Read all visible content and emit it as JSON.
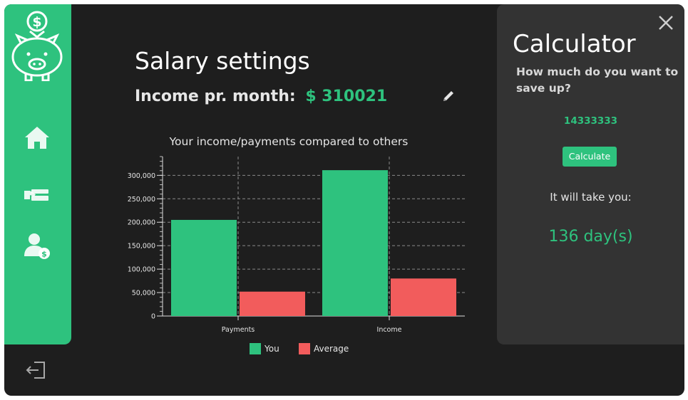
{
  "main": {
    "title": "Salary settings",
    "income_label": "Income pr. month:",
    "income_value": "$ 310021"
  },
  "icons": {
    "logo": "piggy-bank-icon",
    "nav": [
      "home-icon",
      "payments-icon",
      "user-salary-icon"
    ],
    "logout": "logout-icon",
    "edit": "pencil-icon",
    "close": "close-icon"
  },
  "colors": {
    "accent": "#2ec27e",
    "average": "#f25c5c",
    "background": "#1e1e1e",
    "panel": "#333333"
  },
  "chart_data": {
    "type": "bar",
    "title": "Your income/payments compared to others",
    "categories": [
      "Payments",
      "Income"
    ],
    "series": [
      {
        "name": "You",
        "values": [
          205000,
          311000
        ]
      },
      {
        "name": "Average",
        "values": [
          52000,
          80000
        ]
      }
    ],
    "yticks": [
      "0",
      "50,000",
      "100,000",
      "150,000",
      "200,000",
      "250,000",
      "300,000"
    ],
    "ylim": [
      0,
      340000
    ],
    "grid": true,
    "legend": "bottom"
  },
  "calculator": {
    "title": "Calculator",
    "question": "How much do you want to save up?",
    "amount": "14333333",
    "button_label": "Calculate",
    "result_label": "It will take you:",
    "result_value": "136 day(s)"
  }
}
